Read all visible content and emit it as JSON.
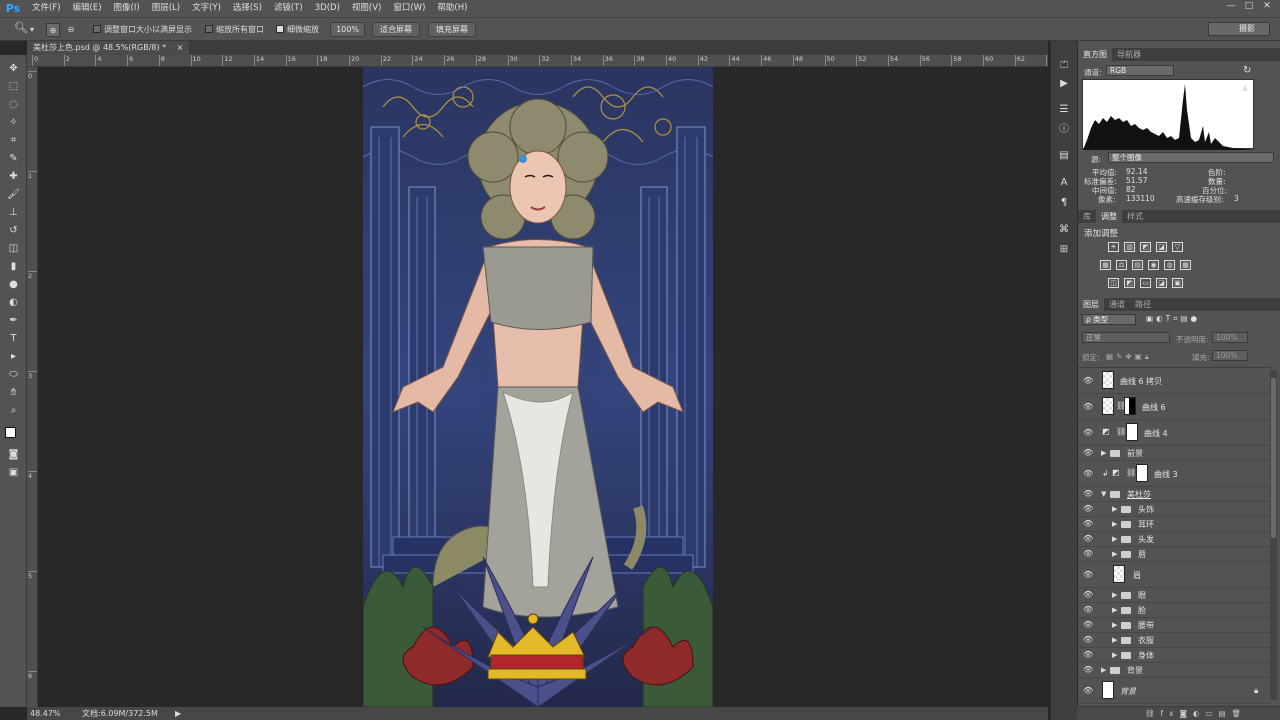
{
  "app": {
    "logo": "Ps"
  },
  "menu": [
    "文件(F)",
    "编辑(E)",
    "图像(I)",
    "图层(L)",
    "文字(Y)",
    "选择(S)",
    "滤镜(T)",
    "3D(D)",
    "视图(V)",
    "窗口(W)",
    "帮助(H)"
  ],
  "window_controls": [
    "—",
    "□",
    "✕"
  ],
  "options": {
    "resize_windows": "调整窗口大小以满屏显示",
    "zoom_all": "缩放所有窗口",
    "scrubby_zoom": "细微缩放",
    "zoom_value": "100%",
    "fit_screen": "适合屏幕",
    "fill_screen": "填充屏幕",
    "workspace": "摄影"
  },
  "document": {
    "tab_title": "美杜莎上色.psd @ 48.5%(RGB/8) *"
  },
  "ruler": {
    "top": [
      "0",
      "2",
      "4",
      "6",
      "8",
      "10",
      "12",
      "14",
      "16",
      "18",
      "20",
      "22",
      "24",
      "26",
      "28",
      "30",
      "32",
      "34",
      "36",
      "38",
      "40",
      "42",
      "44",
      "46",
      "48",
      "50",
      "52",
      "54",
      "56",
      "58",
      "60",
      "62",
      "64"
    ],
    "left": [
      "0",
      "1",
      "2",
      "3",
      "4",
      "5",
      "6"
    ]
  },
  "status": {
    "zoom": "48.47%",
    "doc_size": "文档:6.09M/372.5M",
    "arrow": "▶"
  },
  "histogram": {
    "tabs": [
      "直方图",
      "导航器"
    ],
    "channel_label": "通道:",
    "channel_value": "RGB",
    "source_label": "源:",
    "source_value": "整个图像",
    "stats": {
      "mean_label": "平均值:",
      "mean": "92.14",
      "std_label": "标准偏差:",
      "std": "51.57",
      "median_label": "中间值:",
      "median": "82",
      "pixels_label": "像素:",
      "pixels": "133110",
      "level_label": "色阶:",
      "count_label": "数量:",
      "percentile_label": "百分位:",
      "cache_label": "高速缓存级别:",
      "cache": "3"
    }
  },
  "adjustments": {
    "tabs": [
      "库",
      "调整",
      "样式"
    ],
    "title": "添加调整",
    "row1": [
      "☀",
      "▥",
      "◩",
      "◪",
      "▽"
    ],
    "row2": [
      "▦",
      "⚖",
      "▤",
      "◉",
      "◍",
      "▦"
    ],
    "row3": [
      "◫",
      "◩",
      "▭",
      "◪",
      "▣"
    ]
  },
  "layers_panel": {
    "tabs": [
      "图层",
      "通道",
      "路径"
    ],
    "filter_kind": "ρ 类型",
    "blend_mode": "正常",
    "opacity_label": "不透明度:",
    "opacity_value": "100%",
    "lock_label": "锁定:",
    "fill_label": "填充:",
    "fill_value": "100%",
    "layers": [
      {
        "name": "曲线 6 拷贝",
        "type": "pixel"
      },
      {
        "name": "曲线 6",
        "type": "pixel-mask"
      },
      {
        "name": "曲线 4",
        "type": "adjustment"
      },
      {
        "name": "前景",
        "type": "group"
      },
      {
        "name": "曲线 3",
        "type": "adjustment-clip"
      },
      {
        "name": "美杜莎",
        "type": "group-open"
      },
      {
        "name": "头饰",
        "type": "subgroup"
      },
      {
        "name": "耳环",
        "type": "subgroup"
      },
      {
        "name": "头发",
        "type": "subgroup"
      },
      {
        "name": "唇",
        "type": "subgroup"
      },
      {
        "name": "眉",
        "type": "pixel-sub"
      },
      {
        "name": "眼",
        "type": "subgroup"
      },
      {
        "name": "脸",
        "type": "subgroup"
      },
      {
        "name": "腰带",
        "type": "subgroup"
      },
      {
        "name": "衣服",
        "type": "subgroup"
      },
      {
        "name": "身体",
        "type": "subgroup"
      },
      {
        "name": "背景",
        "type": "group"
      },
      {
        "name": "背景",
        "type": "background"
      }
    ]
  },
  "colors": {
    "accent": "#31a8ff",
    "chrome": "#535353",
    "canvas_bg": "#282828"
  }
}
